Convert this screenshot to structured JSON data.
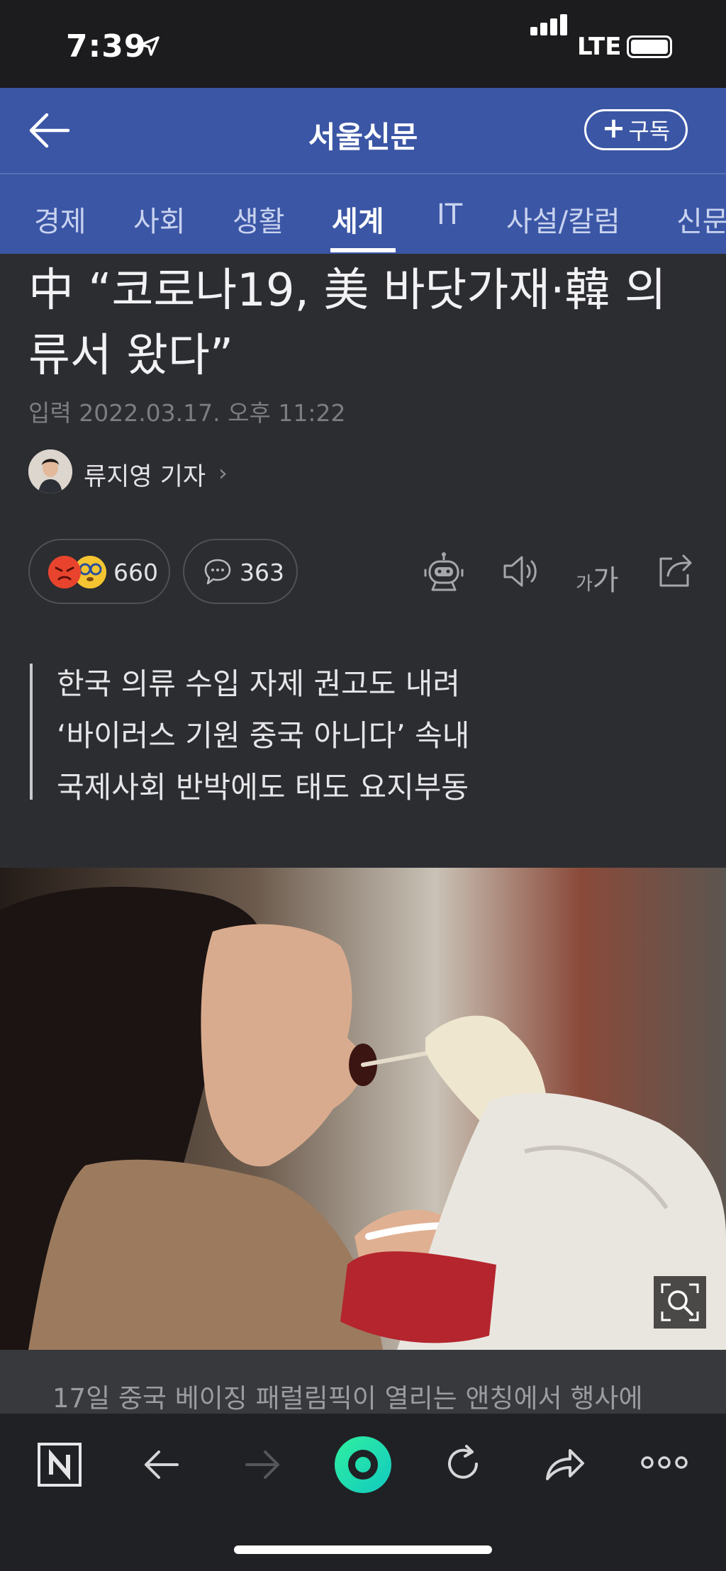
{
  "status_bar": {
    "time": "7:39",
    "network": "LTE"
  },
  "header": {
    "brand": "서울신문",
    "subscribe_label": "구독",
    "subscribe_plus": "+"
  },
  "tabs": [
    {
      "label": "경제"
    },
    {
      "label": "사회"
    },
    {
      "label": "생활"
    },
    {
      "label": "세계",
      "active": true
    },
    {
      "label": "IT"
    },
    {
      "label": "사설/칼럼"
    },
    {
      "label": "신문"
    }
  ],
  "article": {
    "headline_line1": "中 “코로나19, 美 바닷가재·韓 의",
    "headline_line2": "류서 왔다”",
    "dateline": "입력 2022.03.17. 오후 11:22",
    "author": "류지영 기자",
    "author_chevron": "›",
    "reaction_count": "660",
    "comment_count": "363",
    "font_size_small": "가",
    "font_size_large": "가",
    "summary": [
      "한국 의류 수입 자제 권고도 내려",
      "‘바이러스 기원 중국 아니다’ 속내",
      "국제사회 반박에도 태도 요지부동"
    ],
    "caption": "17일 중국 베이징 패럴림픽이 열리는 앤칭에서 행사에"
  },
  "colors": {
    "header_bg": "#3b56a5",
    "page_bg": "#2c2d31",
    "status_bg": "#1c1c1e",
    "bottom_bar_bg": "#202124",
    "accent_green": "#1fd9a1"
  },
  "icons": {
    "back": "arrow-left-icon",
    "reactions": [
      "angry-face-icon",
      "dizzy-face-icon"
    ],
    "comment": "speech-bubble-icon",
    "tools": [
      "robot-icon",
      "speaker-icon",
      "font-size-icon",
      "share-icon"
    ],
    "photo_zoom": "magnify-icon",
    "bottom_bar": [
      "naver-logo-icon",
      "back-arrow-icon",
      "forward-arrow-icon",
      "green-dot-icon",
      "refresh-icon",
      "share-arrow-icon",
      "more-icon"
    ]
  }
}
